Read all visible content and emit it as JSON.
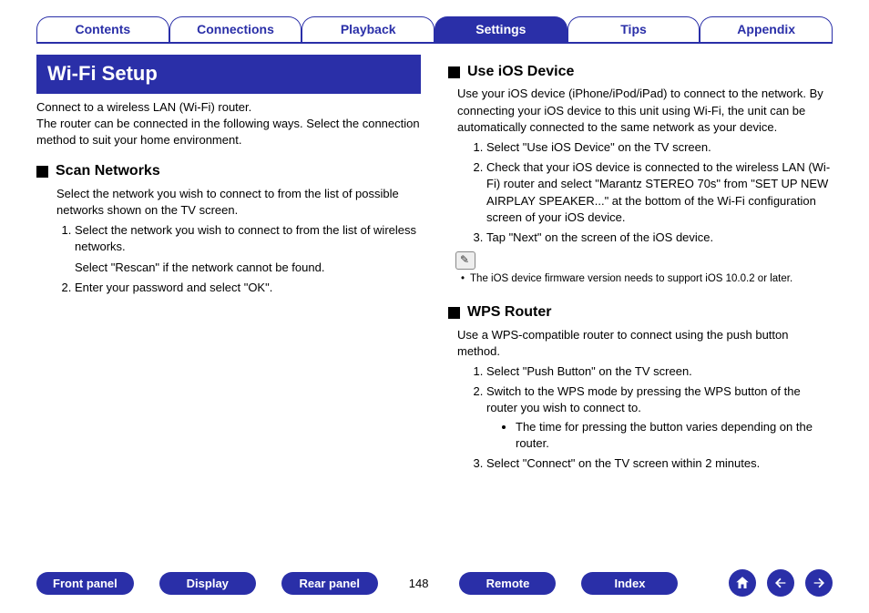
{
  "tabs": {
    "items": [
      "Contents",
      "Connections",
      "Playback",
      "Settings",
      "Tips",
      "Appendix"
    ],
    "active_index": 3
  },
  "left": {
    "banner": "Wi-Fi Setup",
    "intro": "Connect to a wireless LAN (Wi-Fi) router.\nThe router can be connected in the following ways. Select the connection method to suit your home environment.",
    "scan": {
      "title": "Scan Networks",
      "desc": "Select the network you wish to connect to from the list of possible networks shown on the TV screen.",
      "steps": [
        "Select the network you wish to connect to from the list of wireless networks.",
        "Enter your password and select \"OK\"."
      ],
      "step1_extra": "Select \"Rescan\" if the network cannot be found."
    }
  },
  "right": {
    "ios": {
      "title": "Use iOS Device",
      "desc": "Use your iOS device (iPhone/iPod/iPad) to connect to the network. By connecting your iOS device to this unit using Wi-Fi, the unit can be automatically connected to the same network as your device.",
      "steps": [
        "Select \"Use iOS Device\" on the TV screen.",
        "Check that your iOS device is connected to the wireless LAN (Wi-Fi) router and select \"Marantz STEREO 70s\" from \"SET UP NEW AIRPLAY SPEAKER...\" at the bottom of the Wi-Fi configuration screen of your iOS device.",
        "Tap \"Next\" on the screen of the iOS device."
      ],
      "note": "The iOS device firmware version needs to support iOS 10.0.2 or later."
    },
    "wps": {
      "title": "WPS Router",
      "desc": "Use a WPS-compatible router to connect using the push button method.",
      "steps": [
        "Select \"Push Button\" on the TV screen.",
        "Switch to the WPS mode by pressing the WPS button of the router you wish to connect to.",
        "Select \"Connect\" on the TV screen within 2 minutes."
      ],
      "step2_sub": "The time for pressing the button varies depending on the router."
    }
  },
  "footer": {
    "buttons": [
      "Front panel",
      "Display",
      "Rear panel",
      "Remote",
      "Index"
    ],
    "page": "148"
  }
}
